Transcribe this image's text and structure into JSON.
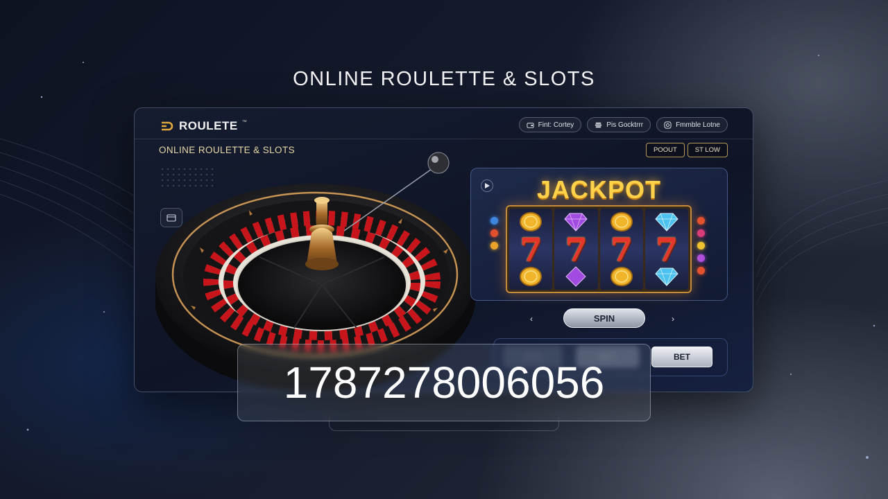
{
  "page": {
    "title": "ONLINE ROULETTE & SLOTS"
  },
  "app": {
    "brand": "ROULETE",
    "brand_tm": "™",
    "nav": [
      {
        "label": "Fint: Cortey",
        "icon": "wallet-icon"
      },
      {
        "label": "Pis Gocktrrr",
        "icon": "stack-icon"
      },
      {
        "label": "Fmmble Lotne",
        "icon": "camera-icon"
      }
    ],
    "subtitle": "ONLINE ROULETTE & SLOTS",
    "actions": [
      "POOUT",
      "ST LOW"
    ],
    "side_icon": "card-icon"
  },
  "slot": {
    "title": "JACKPOT",
    "reels": [
      [
        "coin",
        "7",
        "coin"
      ],
      [
        "gem-purple",
        "7",
        "gem-purple"
      ],
      [
        "coin",
        "7",
        "coin"
      ],
      [
        "gem-blue",
        "7",
        "gem-blue"
      ]
    ],
    "spin_label": "SPIN",
    "prev_label": "‹",
    "next_label": "›"
  },
  "bet": {
    "buttons": [
      "SPIN",
      "BET",
      "BET"
    ]
  },
  "overlay": {
    "number": "1787278006056"
  },
  "colors": {
    "accent_gold": "#e9d7a8",
    "jackpot": "#ffd24a",
    "roulette_red": "#c8151b",
    "roulette_black": "#141414",
    "roulette_green": "#1f7a3a"
  }
}
